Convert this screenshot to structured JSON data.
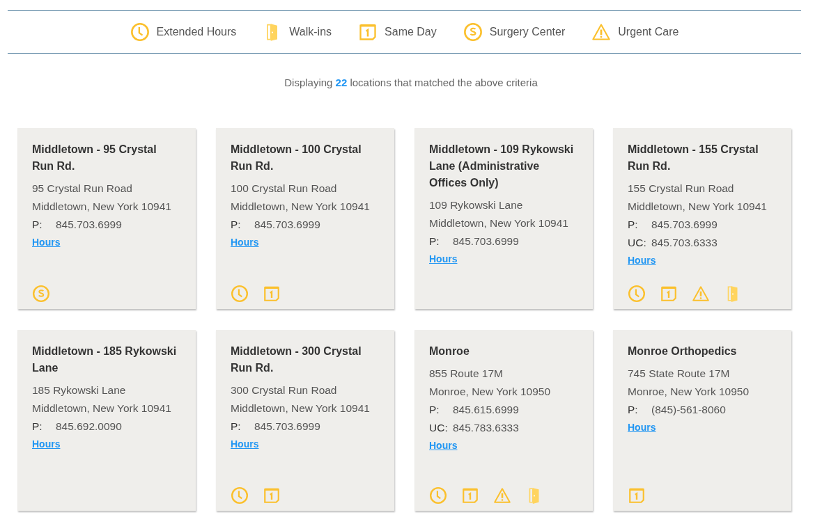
{
  "legend": [
    {
      "kind": "clock",
      "label": "Extended Hours"
    },
    {
      "kind": "door",
      "label": "Walk-ins"
    },
    {
      "kind": "calendar",
      "label": "Same Day"
    },
    {
      "kind": "surgery",
      "label": "Surgery Center"
    },
    {
      "kind": "warning",
      "label": "Urgent Care"
    }
  ],
  "summary": "Displaying **22** locations that matched the above criteria",
  "locations": [
    {
      "name": "Middletown - 95 Crystal Run Rd.",
      "address": [
        "95 Crystal Run Road",
        "Middletown, New York 10941"
      ],
      "phones": [
        {
          "label": "P:",
          "number": "845.703.6999"
        }
      ],
      "hours_link": "Hours",
      "features": [
        {
          "kind": "surgery"
        }
      ]
    },
    {
      "name": "Middletown - 100 Crystal Run Rd.",
      "address": [
        "100 Crystal Run Road",
        "Middletown, New York 10941"
      ],
      "phones": [
        {
          "label": "P:",
          "number": "845.703.6999"
        }
      ],
      "hours_link": "Hours",
      "features": [
        {
          "kind": "clock"
        },
        {
          "kind": "calendar"
        }
      ]
    },
    {
      "name": "Middletown - 109 Rykowski Lane (Administrative Offices Only)",
      "address": [
        "109 Rykowski Lane",
        "Middletown, New York 10941"
      ],
      "phones": [
        {
          "label": "P:",
          "number": "845.703.6999"
        }
      ],
      "hours_link": "Hours"
    },
    {
      "name": "Middletown - 155 Crystal Run Rd.",
      "address": [
        "155 Crystal Run Road",
        "Middletown, New York 10941"
      ],
      "phones": [
        {
          "label": "P:",
          "number": "845.703.6999"
        },
        {
          "label": "UC:",
          "number": "845.703.6333"
        }
      ],
      "hours_link": "Hours",
      "features": [
        {
          "kind": "clock"
        },
        {
          "kind": "calendar"
        },
        {
          "kind": "warning"
        },
        {
          "kind": "door"
        }
      ]
    },
    {
      "name": "Middletown - 185 Rykowski Lane",
      "address": [
        "185 Rykowski Lane",
        "Middletown, New York 10941"
      ],
      "phones": [
        {
          "label": "P:",
          "number": "845.692.0090"
        }
      ],
      "hours_link": "Hours"
    },
    {
      "name": "Middletown - 300 Crystal Run Rd.",
      "address": [
        "300 Crystal Run Road",
        "Middletown, New York 10941"
      ],
      "phones": [
        {
          "label": "P:",
          "number": "845.703.6999"
        }
      ],
      "hours_link": "Hours",
      "features": [
        {
          "kind": "clock"
        },
        {
          "kind": "calendar"
        }
      ]
    },
    {
      "name": "Monroe",
      "address": [
        "855 Route 17M",
        "Monroe, New York 10950"
      ],
      "phones": [
        {
          "label": "P:",
          "number": "845.615.6999"
        },
        {
          "label": "UC:",
          "number": "845.783.6333"
        }
      ],
      "hours_link": "Hours",
      "features": [
        {
          "kind": "clock"
        },
        {
          "kind": "calendar"
        },
        {
          "kind": "warning"
        },
        {
          "kind": "door"
        }
      ]
    },
    {
      "name": "Monroe Orthopedics",
      "address": [
        "745 State Route 17M",
        "Monroe, New York 10950"
      ],
      "phones": [
        {
          "label": "P:",
          "number": "(845)-561-8060"
        }
      ],
      "hours_link": "Hours",
      "features": [
        {
          "kind": "calendar"
        }
      ]
    }
  ]
}
